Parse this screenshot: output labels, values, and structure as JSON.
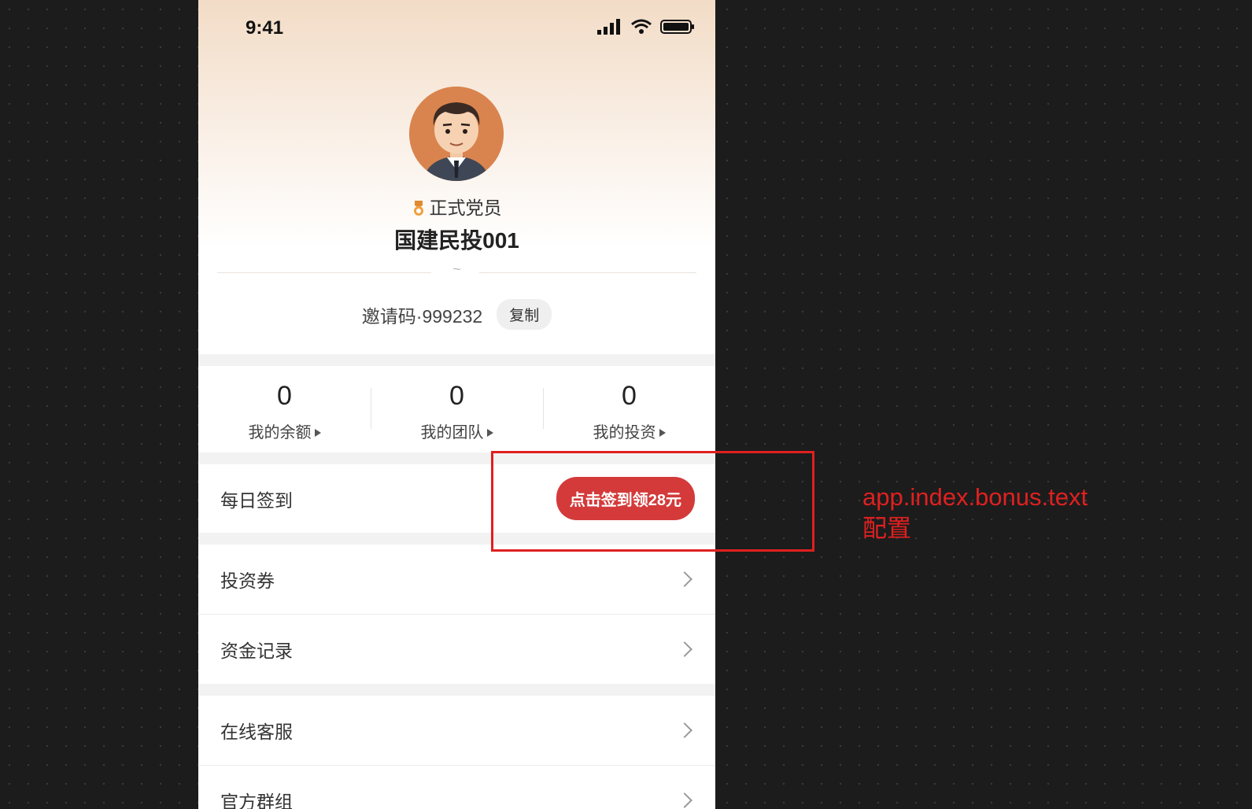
{
  "status_bar": {
    "time": "9:41"
  },
  "profile": {
    "rank": "正式党员",
    "username": "国建民投001",
    "invite_text": "邀请码·999232",
    "copy_label": "复制"
  },
  "stats": [
    {
      "value": "0",
      "label": "我的余额"
    },
    {
      "value": "0",
      "label": "我的团队"
    },
    {
      "value": "0",
      "label": "我的投资"
    }
  ],
  "checkin": {
    "label": "每日签到",
    "button": "点击签到领28元"
  },
  "menu": {
    "coupon": "投资券",
    "funds": "资金记录",
    "service": "在线客服",
    "group": "官方群组"
  },
  "annotation": {
    "line1": "app.index.bonus.text",
    "line2": "配置"
  },
  "colors": {
    "accent": "#d43a3a",
    "annotation": "#e02020",
    "header_top": "#f2dcc6"
  }
}
